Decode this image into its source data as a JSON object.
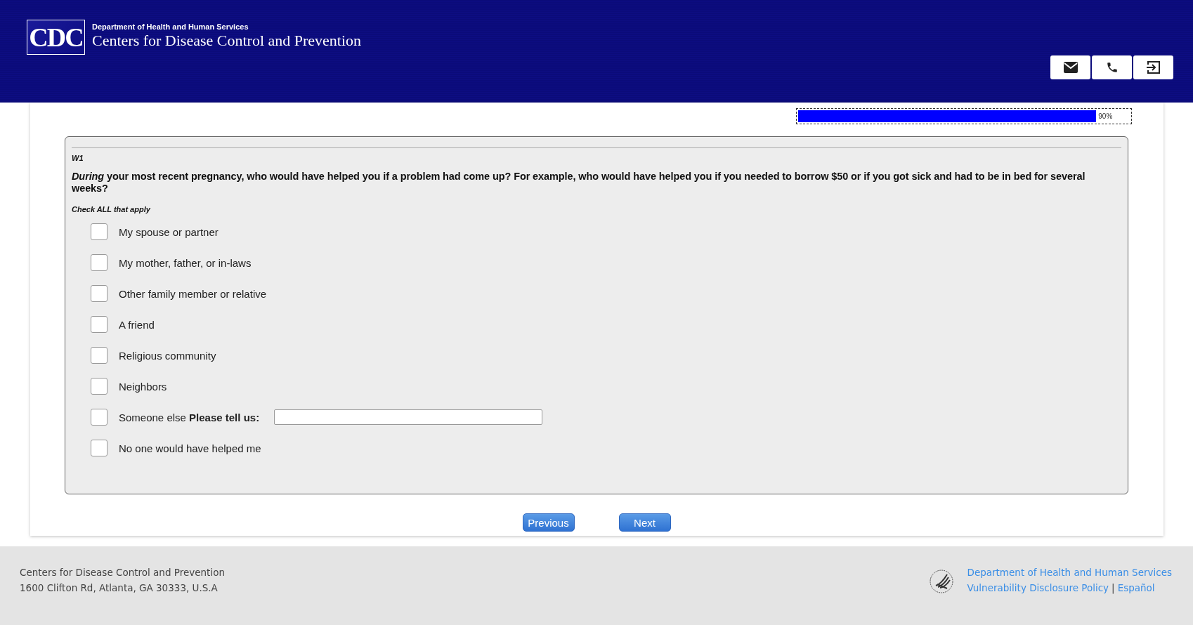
{
  "header": {
    "logo_text": "CDC",
    "department": "Department of Health and Human Services",
    "agency": "Centers for Disease Control and Prevention",
    "buttons": [
      {
        "kind": "mail"
      },
      {
        "kind": "phone"
      },
      {
        "kind": "exit"
      }
    ]
  },
  "progress": {
    "level": 0.9,
    "reading": "90%"
  },
  "question": {
    "id": "W1",
    "text": "*During* your most recent pregnancy, who would have helped you if a problem had come up? For example, who would have helped you if you needed to borrow $50 or if you got sick and had to be in bed for several weeks?",
    "instruction": "Check ALL that apply",
    "options": [
      {
        "kind": "checkbox",
        "label": "My spouse or partner",
        "checked": false
      },
      {
        "kind": "checkbox",
        "label": "My mother, father, or in-laws",
        "checked": false
      },
      {
        "kind": "checkbox",
        "label": "Other family member or relative",
        "checked": false
      },
      {
        "kind": "checkbox",
        "label": "A friend",
        "checked": false
      },
      {
        "kind": "checkbox",
        "label": "Religious community",
        "checked": false
      },
      {
        "kind": "checkbox",
        "label": "Neighbors",
        "checked": false
      },
      {
        "kind": "other",
        "label": "Someone else **Please tell us:**",
        "checked": false
      },
      {
        "kind": "checkbox",
        "label": "No one would have helped me",
        "checked": false
      }
    ]
  },
  "nav": {
    "buttons": [
      "Previous",
      "Next"
    ]
  },
  "footer": {
    "address": [
      "Centers for Disease Control and Prevention",
      "1600 Clifton Rd, Atlanta, GA 30333, U.S.A"
    ],
    "links": [
      "Department of Health and Human Services",
      "Vulnerability Disclosure Policy",
      "Español"
    ],
    "separator": "|"
  }
}
